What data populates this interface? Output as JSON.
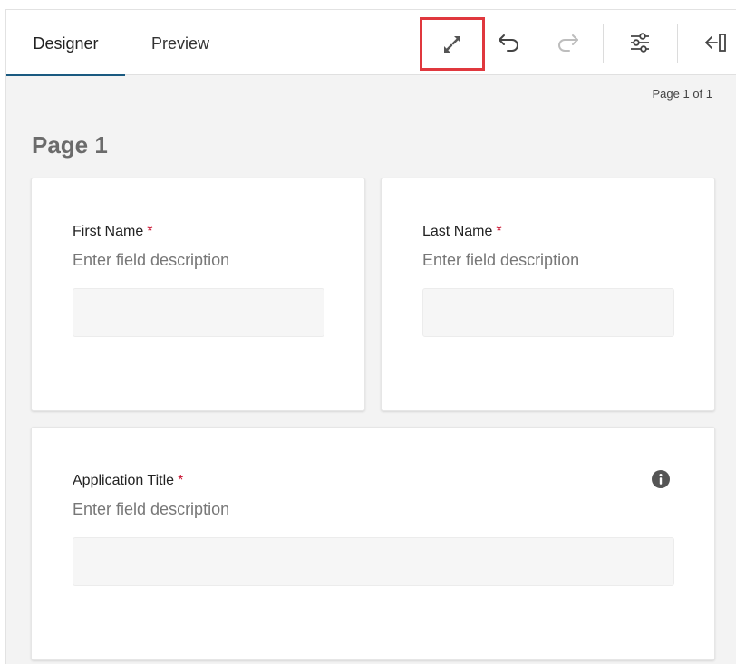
{
  "tabs": {
    "designer": "Designer",
    "preview": "Preview"
  },
  "toolbar": {
    "icons": [
      "expand-icon",
      "undo-icon",
      "redo-icon",
      "settings-sliders-icon",
      "collapse-panel-icon"
    ]
  },
  "pager": {
    "text": "Page 1 of 1"
  },
  "page": {
    "title": "Page 1"
  },
  "fields": [
    {
      "label": "First Name",
      "required_mark": "*",
      "description": "Enter field description"
    },
    {
      "label": "Last Name",
      "required_mark": "*",
      "description": "Enter field description"
    },
    {
      "label": "Application Title",
      "required_mark": "*",
      "description": "Enter field description"
    }
  ],
  "colors": {
    "accent": "#1a5a80",
    "required": "#c8102e",
    "highlight": "#e0383e"
  }
}
